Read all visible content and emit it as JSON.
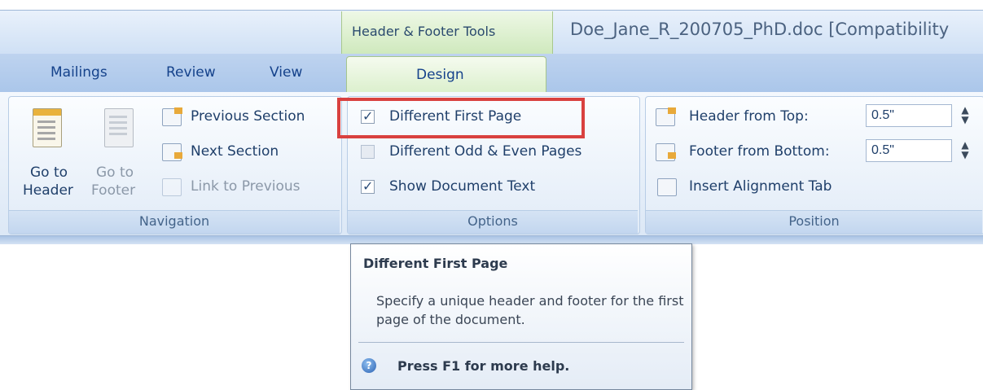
{
  "window": {
    "context_title": "Header & Footer Tools",
    "doc_title": "Doe_Jane_R_200705_PhD.doc [Compatibility"
  },
  "tabs": [
    {
      "label": "Mailings"
    },
    {
      "label": "Review"
    },
    {
      "label": "View"
    },
    {
      "label": "Design",
      "active": true
    }
  ],
  "navigation": {
    "group_label": "Navigation",
    "go_to_header": [
      "Go to",
      "Header"
    ],
    "go_to_footer": [
      "Go to",
      "Footer"
    ],
    "previous_section": "Previous Section",
    "next_section": "Next Section",
    "link_to_previous": "Link to Previous"
  },
  "options": {
    "group_label": "Options",
    "different_first_page": {
      "label": "Different First Page",
      "checked": true
    },
    "different_odd_even": {
      "label": "Different Odd & Even Pages",
      "checked": false
    },
    "show_document_text": {
      "label": "Show Document Text",
      "checked": true
    }
  },
  "position": {
    "group_label": "Position",
    "header_from_top": {
      "label": "Header from Top:",
      "value": "0.5\""
    },
    "footer_from_bottom": {
      "label": "Footer from Bottom:",
      "value": "0.5\""
    },
    "insert_alignment_tab": "Insert Alignment Tab"
  },
  "tooltip": {
    "title": "Different First Page",
    "description": "Specify a unique header and footer for the first page of the document.",
    "help": "Press F1 for more help."
  },
  "colors": {
    "highlight": "#d9413f",
    "accent": "#15428b"
  }
}
